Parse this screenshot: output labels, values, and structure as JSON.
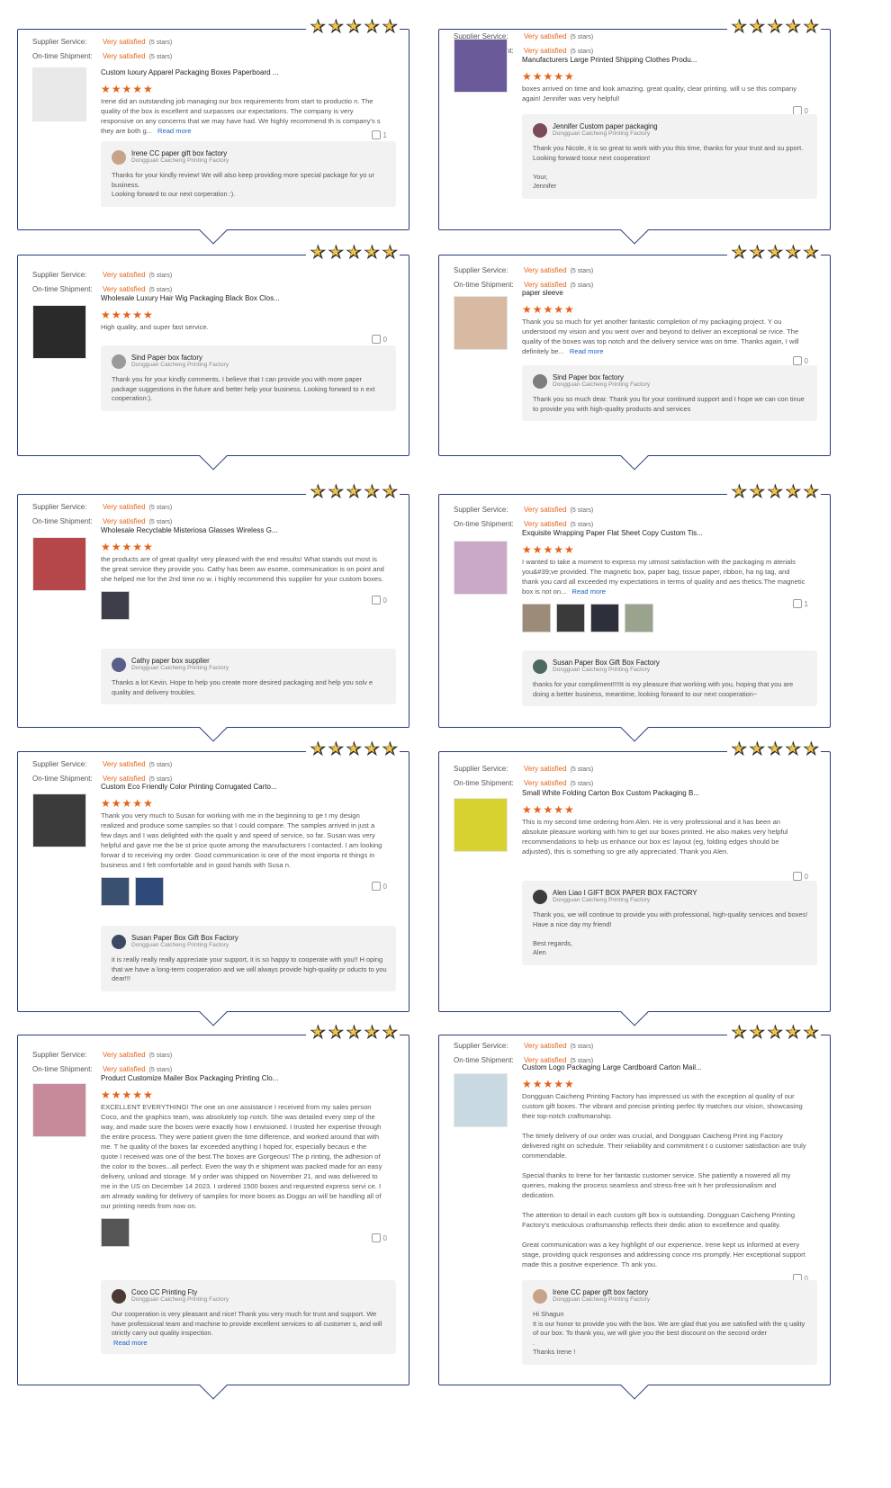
{
  "labels": {
    "supplier": "Supplier Service:",
    "shipment": "On-time Shipment:",
    "rating": "Very satisfied",
    "stars": "(5 stars)",
    "read_more": "Read more",
    "company": "Dongguan Caicheng Printing Factory"
  },
  "reviews": [
    {
      "product": "Custom luxury Apparel Packaging Boxes Paperboard ...",
      "text": "Irene did an outstanding job managing our box requirements from start to productio n. The quality of the box is excellent and surpasses our expectations. The company is very responsive on any concerns that we may have had. We highly recommend th is company's s they are both g...",
      "likes": "1",
      "reply_name": "Irene CC paper gift box factory",
      "reply": "Thanks for your kindly review! We will also keep providing more special package for yo ur business.\nLooking forward to our next corperation :)."
    },
    {
      "product": "Manufacturers Large Printed Shipping Clothes Produ...",
      "text": "boxes arrived on time and look amazing. great quality, clear printing. will u se this company again! Jennifer was very helpful!",
      "likes": "0",
      "reply_name": "Jennifer Custom paper packaging",
      "reply": "Thank you Nicole, it is so great to work with you this time, thanks for your trust and su pport.\nLooking forward toour next cooperation!\n\nYour,\nJennifer"
    },
    {
      "product": "Wholesale Luxury Hair Wig Packaging Black Box Clos...",
      "text": "High quality, and super fast service.",
      "likes": "0",
      "reply_name": "Sind Paper box factory",
      "reply": "Thank you for your kindly comments. I believe that I can provide you with more paper package suggestions in the future and better help your business. Looking forward to n ext cooperation:)."
    },
    {
      "product": "paper sleeve",
      "text": "Thank you so much for yet another fantastic completion of my packaging project. Y ou understood my vision and you went over and beyond to deliver an exceptional se rvice. The quality of the boxes was top notch and the delivery service was on time. Thanks again, I will definitely be...",
      "likes": "0",
      "reply_name": "Sind Paper box factory",
      "reply": "Thank you so much dear. Thank you for your continued support and I hope we can con tinue to provide you with high-quality products and services"
    },
    {
      "product": "Wholesale Recyclable Misteriosa Glasses Wireless G...",
      "text": "the products are of great quality! very pleased with the end results! What stands out most is the great service they provide you. Cathy has been aw esome, communication is on point and she helped me for the 2nd time no w. i highly recommend this supplier for your custom boxes.",
      "likes": "0",
      "reply_name": "Cathy paper box supplier",
      "reply": "Thanks a lot Kevin. Hope to help you create more desired packaging and help you solv e quality and delivery troubles."
    },
    {
      "product": "Exquisite Wrapping Paper Flat Sheet Copy Custom Tis...",
      "text": "I wanted to take a moment to express my utmost satisfaction with the packaging m aterials you&#39;ve provided. The magnetic box, paper bag, tissue paper, ribbon, ha ng tag, and thank you card all exceeded my expectations in terms of quality and aes thetics.The magnetic box is not on...",
      "likes": "1",
      "reply_name": "Susan Paper Box Gift Box Factory",
      "reply": "thanks for your compliment!!!!It is my pleasure that working with you, hoping that you are doing a better business, meantime, looking forward to our next cooperation~"
    },
    {
      "product": "Custom Eco Friendly Color Printing Corrugated Carto...",
      "text": "Thank you very much to Susan for working with me in the beginning to ge t my design realized and produce some samples so that I could compare. The samples arrived in just a few days and I was delighted with the qualit y and speed of service, so far. Susan was very helpful and gave me the be st price quote among the manufacturers I contacted. I am looking forwar d to receiving my order. Good communication is one of the most importa nt things in business and I felt comfortable and in good hands with Susa n.",
      "likes": "0",
      "reply_name": "Susan Paper Box Gift Box Factory",
      "reply": "it is really really really appreciate your support, it is so happy to cooperate with you!! H oping that we have a long-term cooperation and we will always provide high-quality pr oducts to you dear!!!"
    },
    {
      "product": "Small White Folding Carton Box Custom Packaging B...",
      "text": "This is my second time ordering from Alen. He is very professional and it has been an absolute pleasure working with him to get our boxes printed. He also makes very helpful recommendations to help us enhance our box es' layout (eg, folding edges should be adjusted), this is something so gre atly appreciated. Thank you Alen.",
      "likes": "0",
      "reply_name": "Alen Liao I GIFT BOX PAPER BOX FACTORY",
      "reply": "Thank you, we will continue to provide you with professional, high-quality services and boxes! Have a nice day my friend!\n\nBest regards,\nAlen"
    },
    {
      "product": "Product Customize Mailer Box Packaging Printing Clo...",
      "text": "EXCELLENT EVERYTHING! The one on one assistance I received from my sales person Coco, and the graphics team, was absolutely top notch. She was detailed every step of the way, and made sure the boxes were exactly how I envisioned. I trusted her expertise through the entire process. They were patient given the time difference, and worked around that with me. T he quality of the boxes far exceeded anything I hoped for, especially becaus e the quote I received was one of the best.The boxes are Gorgeous! The p rinting, the adhesion of the color to the boxes...all perfect. Even the way th e shipment was packed made for an easy delivery, unload and storage. M y order was shipped on November 21, and was delivered to me in the US on December 14 2023. I ordered 1500 boxes and requested express servi ce. I am already waiting for delivery of samples for more boxes as Doggu an will be handling all of our printing needs from now on.",
      "likes": "0",
      "reply_name": "Coco CC Printing Fty",
      "reply": "Our cooperation is very pleasant and nice! Thank you very much for trust and support. We have professional team and machine to provide excellent services to all customer s, and will strictly carry out quality inspection."
    },
    {
      "product": "Custom Logo Packaging Large Cardboard Carton Mail...",
      "text": "Dongguan Caicheng Printing Factory has impressed us with the exception al quality of our custom gift boxes. The vibrant and precise printing perfec tly matches our vision, showcasing their top-notch craftsmanship.\n\nThe timely delivery of our order was crucial, and Dongguan Caicheng Print ing Factory delivered right on schedule. Their reliability and commitment t o customer satisfaction are truly commendable.\n\nSpecial thanks to Irene for her fantastic customer service. She patiently a nswered all my queries, making the process seamless and stress-free wit h her professionalism and dedication.\n\nThe attention to detail in each custom gift box is outstanding. Dongguan Caicheng Printing Factory's meticulous craftsmanship reflects their dedic ation to excellence and quality.\n\nGreat communication was a key highlight of our experience. Irene kept us informed at every stage, providing quick responses and addressing conce rns promptly. Her exceptional support made this a positive experience. Th ank you.",
      "likes": "0",
      "reply_name": "Irene CC paper gift box factory",
      "reply": "Hi Shagun\nIt is our honor to provide you with the box. We are glad that you are satisfied with the q uality of our box. To thank you, we will give you the best discount on the second order\n.\nThanks Irene !"
    }
  ]
}
